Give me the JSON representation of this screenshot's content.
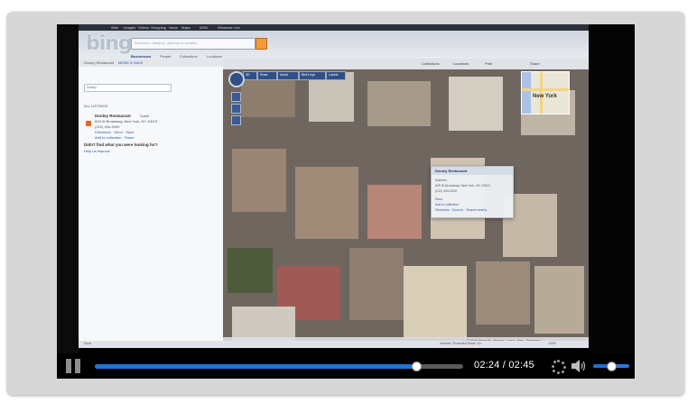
{
  "bing": {
    "topbar": [
      "Web",
      "Images",
      "Videos",
      "Shopping",
      "News",
      "Maps",
      "MSN",
      "Windows Live"
    ],
    "search_placeholder": "Business, category, address or location",
    "subnav": [
      "Businesses",
      "People",
      "Collections",
      "Locations"
    ],
    "left": {
      "breadcrumb": "Dooley Restaurant",
      "breadcrumb_link": "MORE & SAVE",
      "field": "Dooley",
      "section_label": "ALL LISTINGS",
      "result_name": "Dooley Restaurant",
      "result_rank": "Sushi",
      "result_address": "625 W Broadway, New York, NY 10013",
      "result_phone": "(212) 494-2020",
      "result_links": "Directions · Send · Save",
      "result_extra": "Add to collection · Share",
      "question": "Didn't find what you were looking for?",
      "help_link": "Help us improve"
    },
    "map_toolbar": [
      "Road",
      "Aerial",
      "Bird's eye",
      "Labels",
      "Collections",
      "Locations",
      "Print",
      "Share"
    ],
    "map_modes": [
      "3D",
      "Road",
      "Aerial",
      "Bird's eye",
      "Labels"
    ],
    "minimap_label": "New York",
    "popup": {
      "title": "Dooley Restaurant",
      "line1": "Address",
      "line2": "625 W Broadway, New York, NY 10013",
      "line3": "(212) 494-2020",
      "line4": "Send",
      "line5": "Add to collection",
      "line6": "Directions · Zoom in · Search nearby"
    },
    "map_footer": "© 2009 Microsoft · Privacy · Legal · Help · Feedback",
    "ie_status": [
      "Done",
      "Internet | Protected Mode: On",
      "100%"
    ]
  },
  "player": {
    "current_time": "02:24",
    "separator": "/",
    "duration": "02:45",
    "progress": 0.873,
    "volume": 0.5
  }
}
